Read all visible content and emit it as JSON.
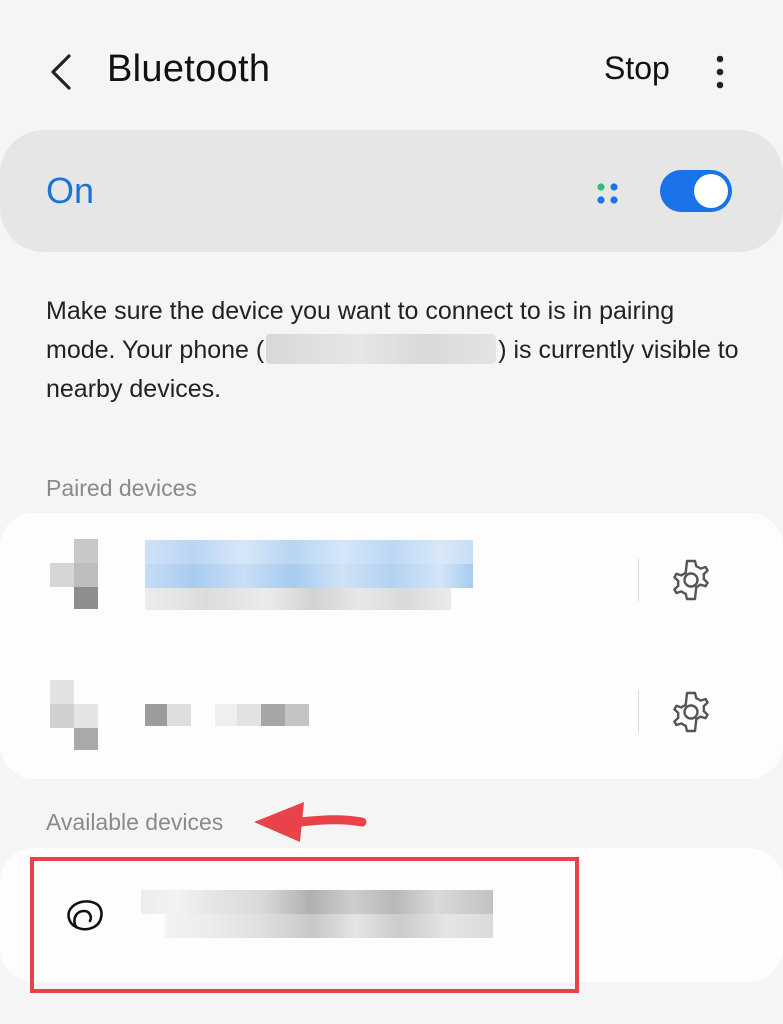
{
  "header": {
    "back_icon": "chevron-left-icon",
    "title": "Bluetooth",
    "stop_label": "Stop",
    "more_icon": "more-vertical-icon"
  },
  "master_switch": {
    "label": "On",
    "state": "on",
    "accent_color": "#1a73e8"
  },
  "description": {
    "part1": "Make sure the device you want to connect to is in pairing mode. Your phone (",
    "part2": ") is currently visible to nearby devices."
  },
  "paired_section": {
    "title": "Paired devices",
    "devices": [
      {
        "icon": "redacted-device-icon",
        "settings_icon": "gear-icon"
      },
      {
        "icon": "redacted-device-icon",
        "settings_icon": "gear-icon"
      }
    ]
  },
  "available_section": {
    "title": "Available devices",
    "devices": [
      {
        "icon": "earbud-icon"
      }
    ]
  },
  "annotation": {
    "highlight_color": "#e8434a"
  }
}
